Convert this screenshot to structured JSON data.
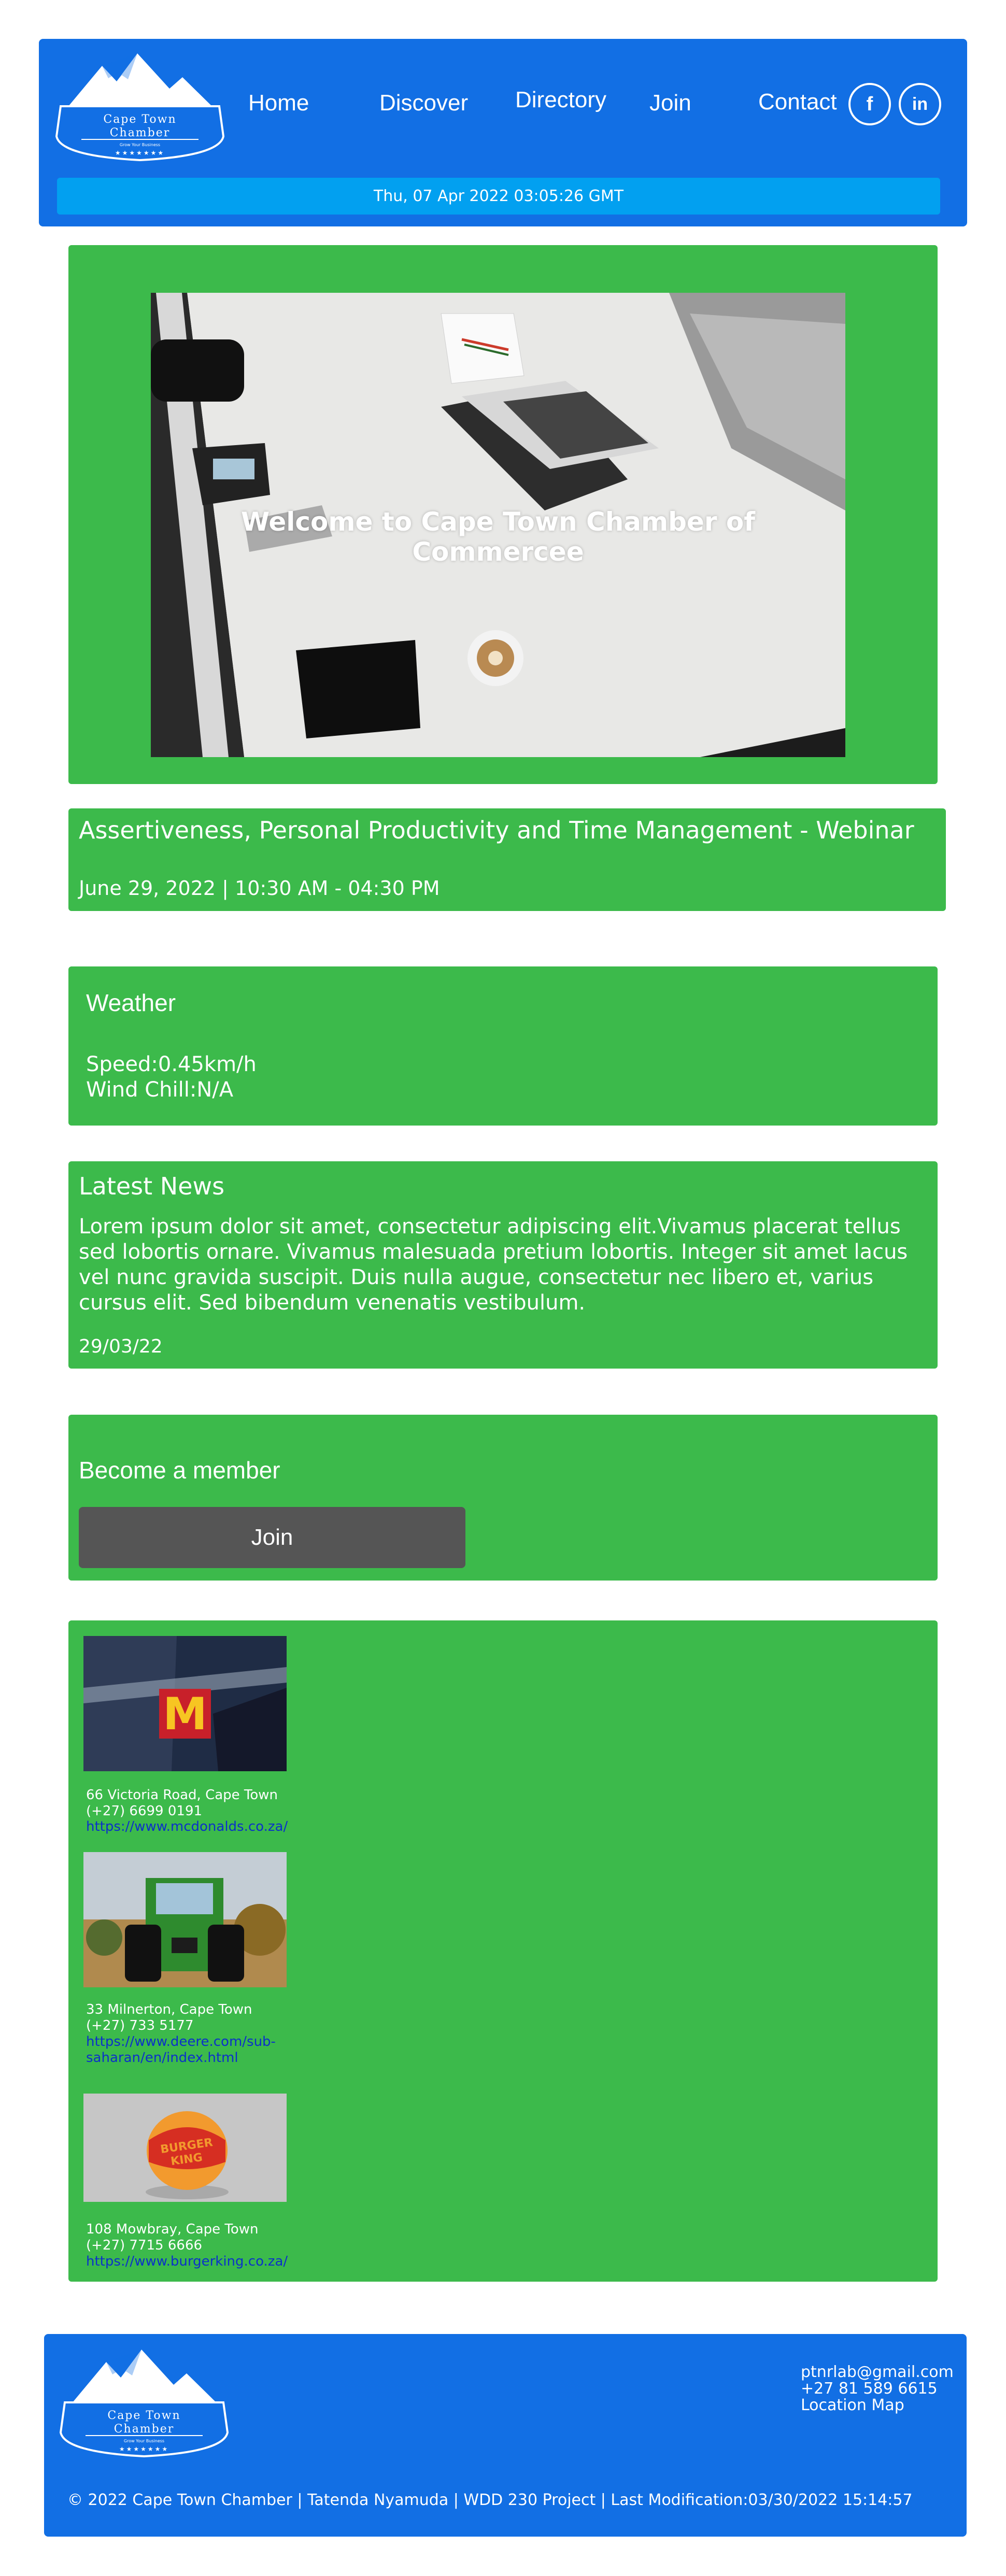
{
  "header": {
    "logo": {
      "name_line1": "Cape Town",
      "name_line2": "Chamber",
      "tagline": "Grow Your Business",
      "stars": "★★★★★★★"
    },
    "nav": [
      "Home",
      "Discover",
      "Directory",
      "Join",
      "Contact"
    ],
    "social": {
      "facebook": "f",
      "linkedin": "in"
    },
    "datetime": "Thu, 07 Apr 2022 03:05:26 GMT"
  },
  "hero": {
    "title": "Welcome to Cape Town Chamber of Commercee"
  },
  "event": {
    "title": "Assertiveness, Personal Productivity and Time Management - Webinar",
    "date": "June 29, 2022 | 10:30 AM - 04:30 PM"
  },
  "weather": {
    "heading": "Weather",
    "speed": "Speed:0.45km/h",
    "wind_chill": "Wind Chill:N/A"
  },
  "news": {
    "heading": "Latest News",
    "body": "Lorem ipsum dolor sit amet, consectetur adipiscing elit.Vivamus placerat tellus sed lobortis ornare. Vivamus malesuada pretium lobortis. Integer sit amet lacus vel nunc gravida suscipit. Duis nulla augue, consectetur nec libero et, varius cursus elit. Sed bibendum venenatis vestibulum.",
    "date": "29/03/22"
  },
  "membership": {
    "heading": "Become a member",
    "button": "Join"
  },
  "directory": [
    {
      "address": "66 Victoria Road, Cape Town",
      "phone": "(+27) 6699 0191",
      "url": "https://www.mcdonalds.co.za/",
      "image_icon": "mcdonalds-sign"
    },
    {
      "address": "33 Milnerton, Cape Town",
      "phone": "(+27) 733 5177",
      "url": "https://www.deere.com/sub-saharan/en/index.html",
      "image_icon": "tractor"
    },
    {
      "address": "108 Mowbray, Cape Town",
      "phone": "(+27) 7715 6666",
      "url": "https://www.burgerking.co.za/",
      "image_icon": "burger-king-logo"
    }
  ],
  "footer": {
    "email": "ptnrlab@gmail.com",
    "phone": "+27 81 589 6615",
    "map": "Location Map",
    "copyright": "© 2022 Cape Town Chamber | Tatenda Nyamuda | WDD 230 Project | Last Modification:03/30/2022 15:14:57"
  },
  "colors": {
    "header_blue": "#126fe4",
    "date_bar": "#02a0f0",
    "panel_green": "#3cba4b",
    "button_gray": "#555555",
    "link_blue": "#0b31c9"
  }
}
